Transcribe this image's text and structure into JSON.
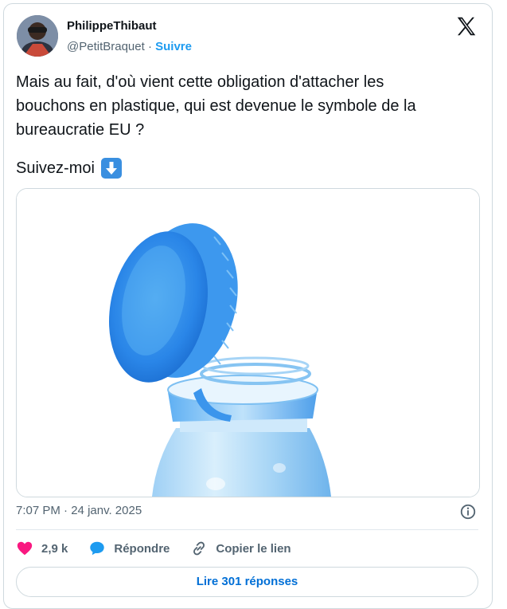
{
  "author": {
    "display_name": "PhilippeThibaut",
    "handle": "@PetitBraquet",
    "separator": "·",
    "follow_label": "Suivre"
  },
  "tweet": {
    "text_lines": [
      "Mais au fait, d'où vient cette obligation d'attacher les",
      "bouchons en plastique, qui est devenue le symbole de la",
      "bureaucratie EU ?"
    ],
    "follow_text": "Suivez-moi",
    "follow_emoji": "arrow-down-emoji",
    "image_alt_description": "bottle-cap-image"
  },
  "meta": {
    "time": "7:07 PM",
    "separator": "·",
    "date": "24 janv. 2025"
  },
  "actions": {
    "likes_count": "2,9 k",
    "reply_label": "Répondre",
    "copy_link_label": "Copier le lien"
  },
  "replies_button_label": "Lire 301 réponses",
  "colors": {
    "accent": "#1d9bf0",
    "link": "#006fd6",
    "like": "#f91880",
    "reply": "#1d9bf0",
    "text": "#0f1419",
    "muted": "#536471",
    "border": "#cfd9de"
  }
}
